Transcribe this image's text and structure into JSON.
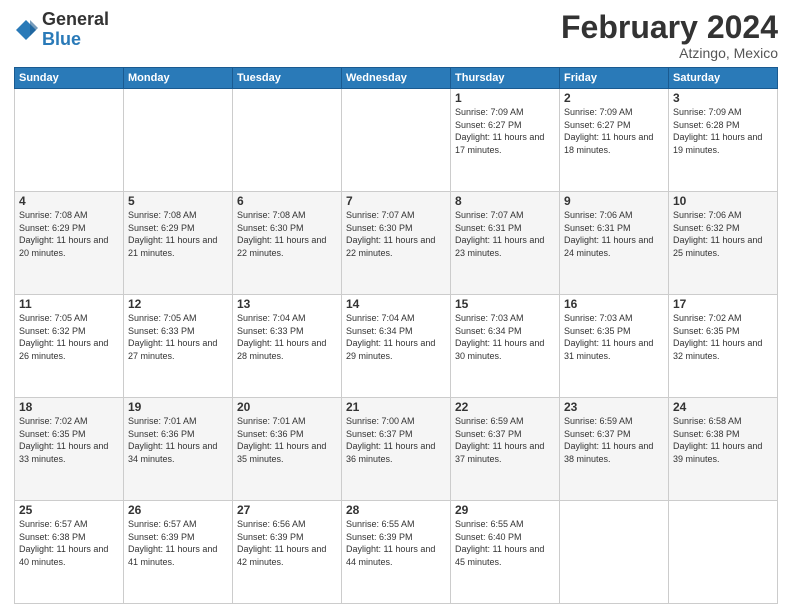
{
  "header": {
    "logo": {
      "general": "General",
      "blue": "Blue"
    },
    "title": "February 2024",
    "location": "Atzingo, Mexico"
  },
  "weekdays": [
    "Sunday",
    "Monday",
    "Tuesday",
    "Wednesday",
    "Thursday",
    "Friday",
    "Saturday"
  ],
  "weeks": [
    [
      {
        "day": "",
        "info": ""
      },
      {
        "day": "",
        "info": ""
      },
      {
        "day": "",
        "info": ""
      },
      {
        "day": "",
        "info": ""
      },
      {
        "day": "1",
        "info": "Sunrise: 7:09 AM\nSunset: 6:27 PM\nDaylight: 11 hours\nand 17 minutes."
      },
      {
        "day": "2",
        "info": "Sunrise: 7:09 AM\nSunset: 6:27 PM\nDaylight: 11 hours\nand 18 minutes."
      },
      {
        "day": "3",
        "info": "Sunrise: 7:09 AM\nSunset: 6:28 PM\nDaylight: 11 hours\nand 19 minutes."
      }
    ],
    [
      {
        "day": "4",
        "info": "Sunrise: 7:08 AM\nSunset: 6:29 PM\nDaylight: 11 hours\nand 20 minutes."
      },
      {
        "day": "5",
        "info": "Sunrise: 7:08 AM\nSunset: 6:29 PM\nDaylight: 11 hours\nand 21 minutes."
      },
      {
        "day": "6",
        "info": "Sunrise: 7:08 AM\nSunset: 6:30 PM\nDaylight: 11 hours\nand 22 minutes."
      },
      {
        "day": "7",
        "info": "Sunrise: 7:07 AM\nSunset: 6:30 PM\nDaylight: 11 hours\nand 22 minutes."
      },
      {
        "day": "8",
        "info": "Sunrise: 7:07 AM\nSunset: 6:31 PM\nDaylight: 11 hours\nand 23 minutes."
      },
      {
        "day": "9",
        "info": "Sunrise: 7:06 AM\nSunset: 6:31 PM\nDaylight: 11 hours\nand 24 minutes."
      },
      {
        "day": "10",
        "info": "Sunrise: 7:06 AM\nSunset: 6:32 PM\nDaylight: 11 hours\nand 25 minutes."
      }
    ],
    [
      {
        "day": "11",
        "info": "Sunrise: 7:05 AM\nSunset: 6:32 PM\nDaylight: 11 hours\nand 26 minutes."
      },
      {
        "day": "12",
        "info": "Sunrise: 7:05 AM\nSunset: 6:33 PM\nDaylight: 11 hours\nand 27 minutes."
      },
      {
        "day": "13",
        "info": "Sunrise: 7:04 AM\nSunset: 6:33 PM\nDaylight: 11 hours\nand 28 minutes."
      },
      {
        "day": "14",
        "info": "Sunrise: 7:04 AM\nSunset: 6:34 PM\nDaylight: 11 hours\nand 29 minutes."
      },
      {
        "day": "15",
        "info": "Sunrise: 7:03 AM\nSunset: 6:34 PM\nDaylight: 11 hours\nand 30 minutes."
      },
      {
        "day": "16",
        "info": "Sunrise: 7:03 AM\nSunset: 6:35 PM\nDaylight: 11 hours\nand 31 minutes."
      },
      {
        "day": "17",
        "info": "Sunrise: 7:02 AM\nSunset: 6:35 PM\nDaylight: 11 hours\nand 32 minutes."
      }
    ],
    [
      {
        "day": "18",
        "info": "Sunrise: 7:02 AM\nSunset: 6:35 PM\nDaylight: 11 hours\nand 33 minutes."
      },
      {
        "day": "19",
        "info": "Sunrise: 7:01 AM\nSunset: 6:36 PM\nDaylight: 11 hours\nand 34 minutes."
      },
      {
        "day": "20",
        "info": "Sunrise: 7:01 AM\nSunset: 6:36 PM\nDaylight: 11 hours\nand 35 minutes."
      },
      {
        "day": "21",
        "info": "Sunrise: 7:00 AM\nSunset: 6:37 PM\nDaylight: 11 hours\nand 36 minutes."
      },
      {
        "day": "22",
        "info": "Sunrise: 6:59 AM\nSunset: 6:37 PM\nDaylight: 11 hours\nand 37 minutes."
      },
      {
        "day": "23",
        "info": "Sunrise: 6:59 AM\nSunset: 6:37 PM\nDaylight: 11 hours\nand 38 minutes."
      },
      {
        "day": "24",
        "info": "Sunrise: 6:58 AM\nSunset: 6:38 PM\nDaylight: 11 hours\nand 39 minutes."
      }
    ],
    [
      {
        "day": "25",
        "info": "Sunrise: 6:57 AM\nSunset: 6:38 PM\nDaylight: 11 hours\nand 40 minutes."
      },
      {
        "day": "26",
        "info": "Sunrise: 6:57 AM\nSunset: 6:39 PM\nDaylight: 11 hours\nand 41 minutes."
      },
      {
        "day": "27",
        "info": "Sunrise: 6:56 AM\nSunset: 6:39 PM\nDaylight: 11 hours\nand 42 minutes."
      },
      {
        "day": "28",
        "info": "Sunrise: 6:55 AM\nSunset: 6:39 PM\nDaylight: 11 hours\nand 44 minutes."
      },
      {
        "day": "29",
        "info": "Sunrise: 6:55 AM\nSunset: 6:40 PM\nDaylight: 11 hours\nand 45 minutes."
      },
      {
        "day": "",
        "info": ""
      },
      {
        "day": "",
        "info": ""
      }
    ]
  ]
}
